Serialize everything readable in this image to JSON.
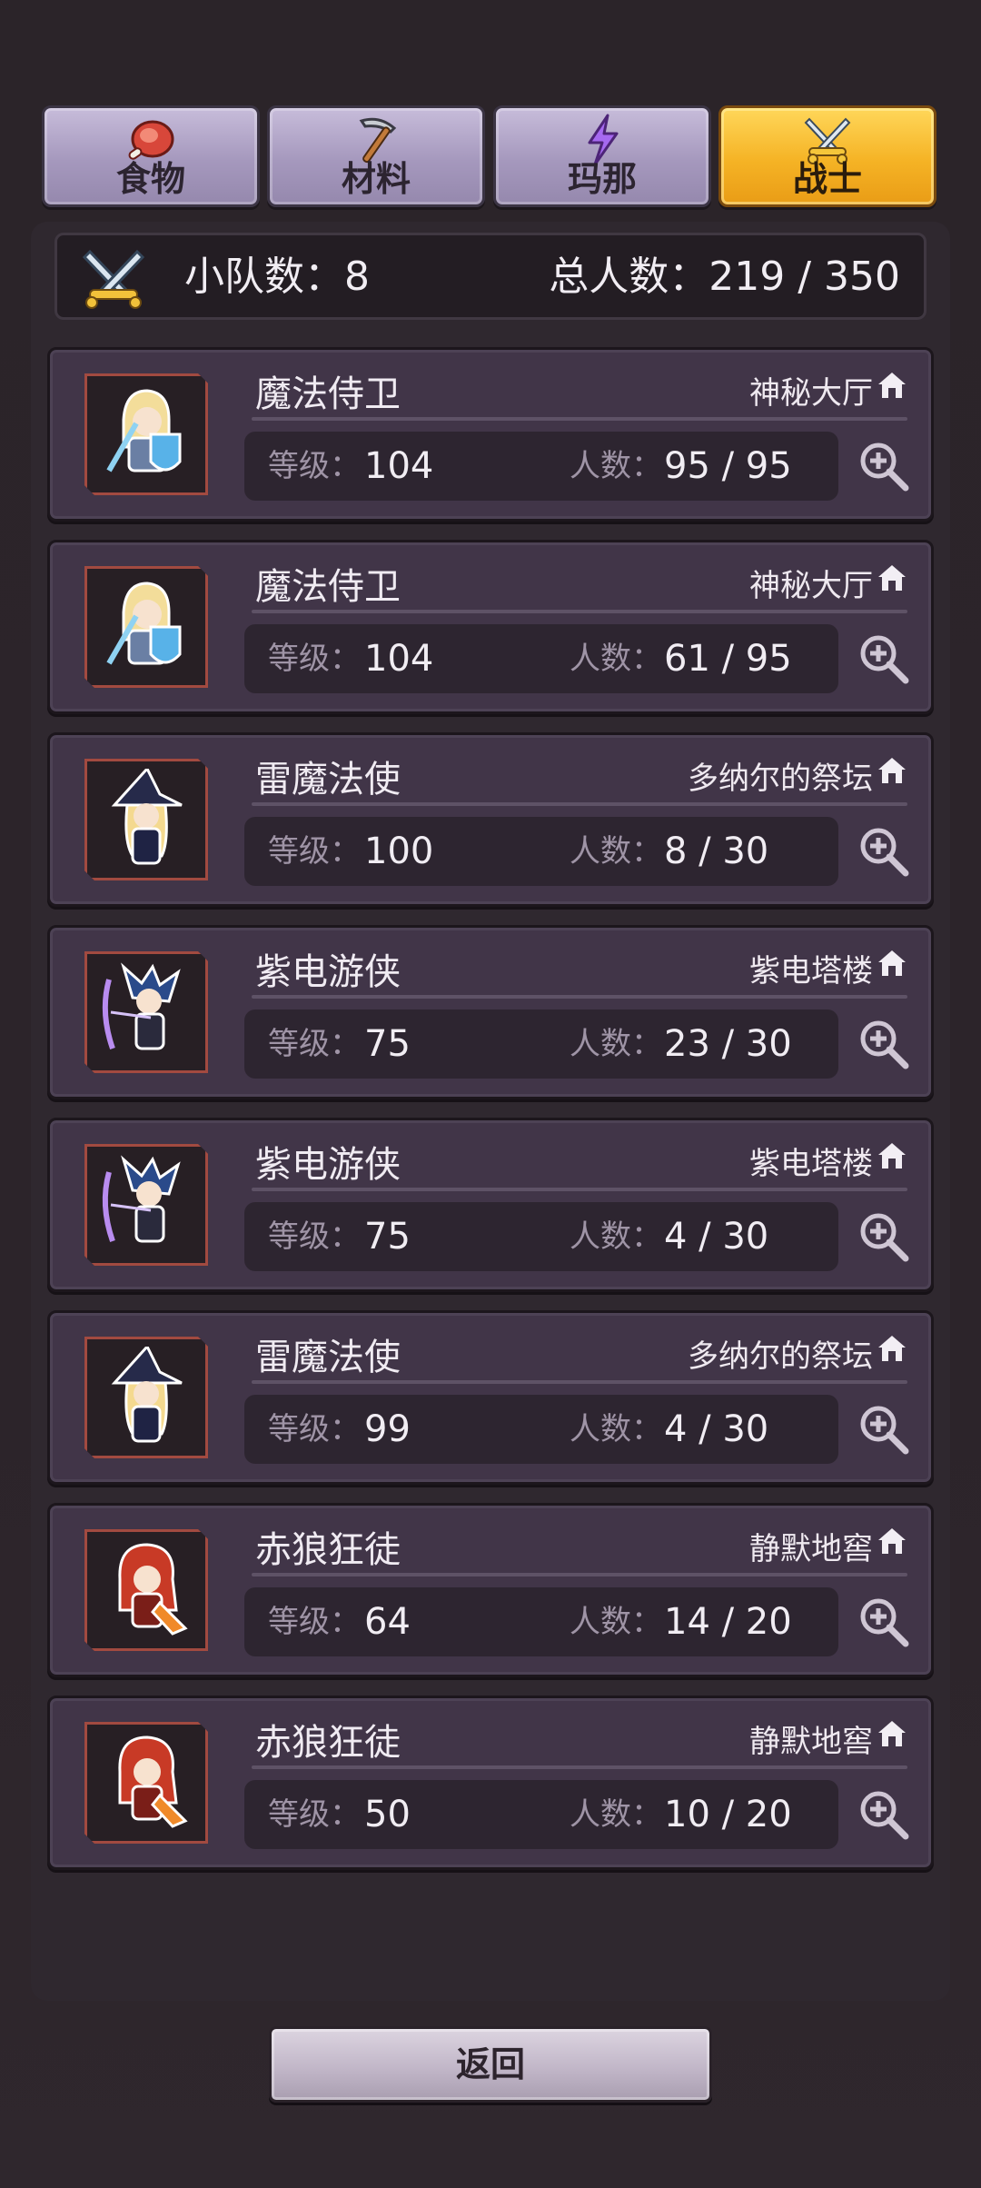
{
  "tabs": [
    {
      "label": "食物",
      "icon": "meat-icon",
      "active": false
    },
    {
      "label": "材料",
      "icon": "pickaxe-icon",
      "active": false
    },
    {
      "label": "玛那",
      "icon": "lightning-icon",
      "active": false
    },
    {
      "label": "战士",
      "icon": "crossed-swords-icon",
      "active": true
    }
  ],
  "summary": {
    "squad_label": "小队数：",
    "squad_count": "8",
    "total_label": "总人数：",
    "total_value": "219 / 350"
  },
  "labels": {
    "level": "等级：",
    "count": "人数："
  },
  "squads": [
    {
      "name": "魔法侍卫",
      "location": "神秘大厅",
      "level": "104",
      "count": "95 / 95",
      "portrait": "knight-shield-portrait"
    },
    {
      "name": "魔法侍卫",
      "location": "神秘大厅",
      "level": "104",
      "count": "61 / 95",
      "portrait": "knight-shield-portrait"
    },
    {
      "name": "雷魔法使",
      "location": "多纳尔的祭坛",
      "level": "100",
      "count": "8 / 30",
      "portrait": "witch-portrait"
    },
    {
      "name": "紫电游侠",
      "location": "紫电塔楼",
      "level": "75",
      "count": "23 / 30",
      "portrait": "ranger-portrait"
    },
    {
      "name": "紫电游侠",
      "location": "紫电塔楼",
      "level": "75",
      "count": "4 / 30",
      "portrait": "ranger-portrait"
    },
    {
      "name": "雷魔法使",
      "location": "多纳尔的祭坛",
      "level": "99",
      "count": "4 / 30",
      "portrait": "witch-portrait"
    },
    {
      "name": "赤狼狂徒",
      "location": "静默地窖",
      "level": "64",
      "count": "14 / 20",
      "portrait": "red-wolf-portrait"
    },
    {
      "name": "赤狼狂徒",
      "location": "静默地窖",
      "level": "50",
      "count": "10 / 20",
      "portrait": "red-wolf-portrait"
    }
  ],
  "back_button": "返回",
  "colors": {
    "active_tab": "#f5b325",
    "inactive_tab": "#a598bd",
    "card_bg": "#413548",
    "portrait_border": "#a24a40"
  }
}
